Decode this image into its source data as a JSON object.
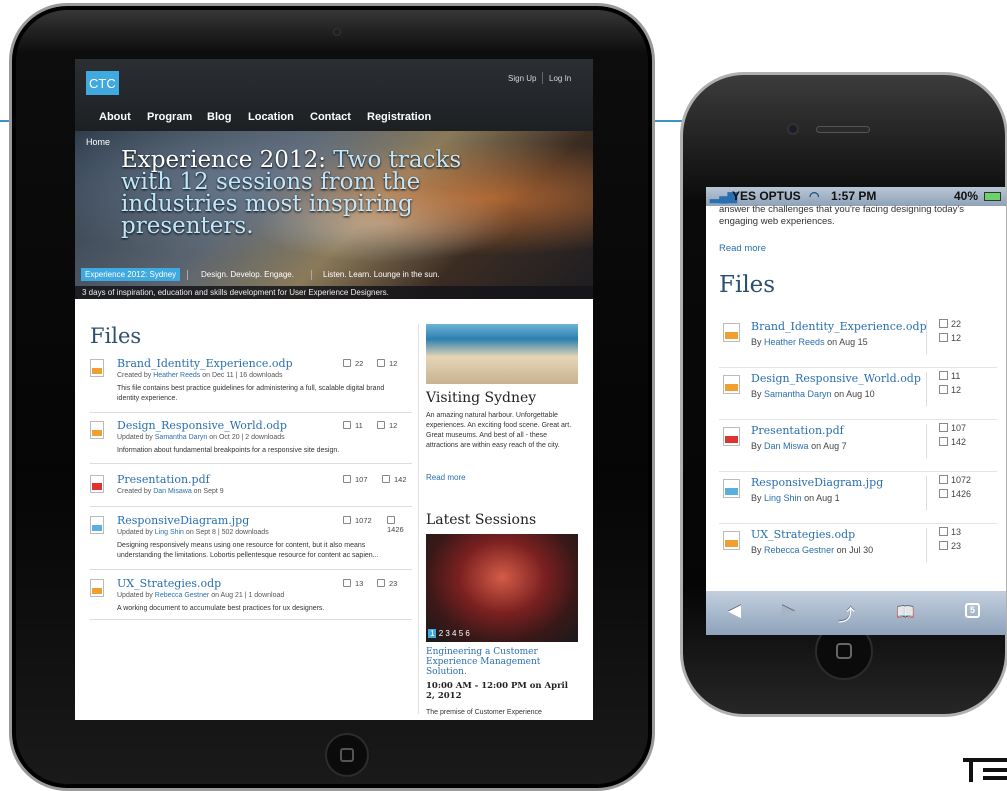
{
  "ipad_site": {
    "logo": "CTC",
    "util_links": [
      "Sign Up",
      "Log In"
    ],
    "nav": [
      "About",
      "Program",
      "Blog",
      "Location",
      "Contact",
      "Registration"
    ],
    "breadcrumb": "Home",
    "hero_title_plain": "Experience 2012:",
    "hero_title_hl": "Two tracks with 12 sessions from the industries most inspiring presenters.",
    "hero_pill": "Experience 2012: Sydney",
    "hero_tag1": "Design. Develop. Engage.",
    "hero_tag2": "Listen. Learn. Lounge in the sun.",
    "hero_sub": "3 days of inspiration, education and skills development for User Experience Designers.",
    "files_heading": "Files",
    "files": [
      {
        "name": "Brand_Identity_Experience.odp",
        "verb": "Created by",
        "author": "Heather Reeds",
        "date_text": "on Dec 11  |  16 downloads",
        "desc": "This file contains best practice guidelines for administering a full, scalable digital brand identity experience.",
        "a": "22",
        "b": "12",
        "type": "odp"
      },
      {
        "name": "Design_Responsive_World.odp",
        "verb": "Updated by",
        "author": "Samantha Daryn",
        "date_text": "on Oct 20  |  2 downloads",
        "desc": "Information about fundamental breakpoints for a responsive site design.",
        "a": "11",
        "b": "12",
        "type": "odp"
      },
      {
        "name": "Presentation.pdf",
        "verb": "Created by",
        "author": "Dan Misawa",
        "date_text": "on Sept 9",
        "desc": "",
        "a": "107",
        "b": "142",
        "type": "pdf"
      },
      {
        "name": "ResponsiveDiagram.jpg",
        "verb": "Updated by",
        "author": "Ling Shin",
        "date_text": "on Sept 8  |  502 downloads",
        "desc": "Designing responsively means using one resource for content, but it also means understanding the limitations. Lobortis pellentesque resource for content ac sapien...",
        "a": "1072",
        "b": "1426",
        "type": "img"
      },
      {
        "name": "UX_Strategies.odp",
        "verb": "Updated by",
        "author": "Rebecca Gestner",
        "date_text": "on Aug 21  |  1 download",
        "desc": "A working document to accumulate best practices for ux designers.",
        "a": "13",
        "b": "23",
        "type": "odp"
      }
    ],
    "sidebar": {
      "visit_heading": "Visiting Sydney",
      "visit_text": "An amazing natural harbour. Unforgettable experiences. An exciting food scene. Great art. Great museums. And best of all - these attractions are within easy reach of the city.",
      "visit_link": "Read more",
      "sessions_heading": "Latest Sessions",
      "pager_current": "1",
      "pager_rest": "2 3 4 5 6",
      "session_title": "Engineering a Customer Experience Management Solution.",
      "session_time": "10:00 AM - 12:00 PM on April 2, 2012",
      "session_text": "The premise of Customer Experience"
    }
  },
  "iphone": {
    "status": {
      "carrier": "YES OPTUS",
      "time": "1:57 PM",
      "battery": "40%"
    },
    "intro": "answer the challenges that you're facing designing today's engaging web experiences.",
    "read_more": "Read more",
    "files_heading": "Files",
    "files": [
      {
        "name": "Brand_Identity_Experience.odp",
        "author": "Heather Reeds",
        "date": "on Aug 15",
        "a": "22",
        "b": "12",
        "type": "odp"
      },
      {
        "name": "Design_Responsive_World.odp",
        "author": "Samantha Daryn",
        "date": "on Aug 10",
        "a": "11",
        "b": "12",
        "type": "odp"
      },
      {
        "name": "Presentation.pdf",
        "author": "Dan Miswa",
        "date": "on Aug 7",
        "a": "107",
        "b": "142",
        "type": "pdf"
      },
      {
        "name": "ResponsiveDiagram.jpg",
        "author": "Ling Shin",
        "date": "on Aug 1",
        "a": "1072",
        "b": "1426",
        "type": "img"
      },
      {
        "name": "UX_Strategies.odp",
        "author": "Rebecca Gestner",
        "date": "on Jul 30",
        "a": "13",
        "b": "23",
        "type": "odp"
      }
    ],
    "toolbar": {
      "back": "◀",
      "forward": "▶",
      "share": "⤴",
      "bookmarks": "📖",
      "tabs": "5"
    }
  },
  "by_label": "By"
}
